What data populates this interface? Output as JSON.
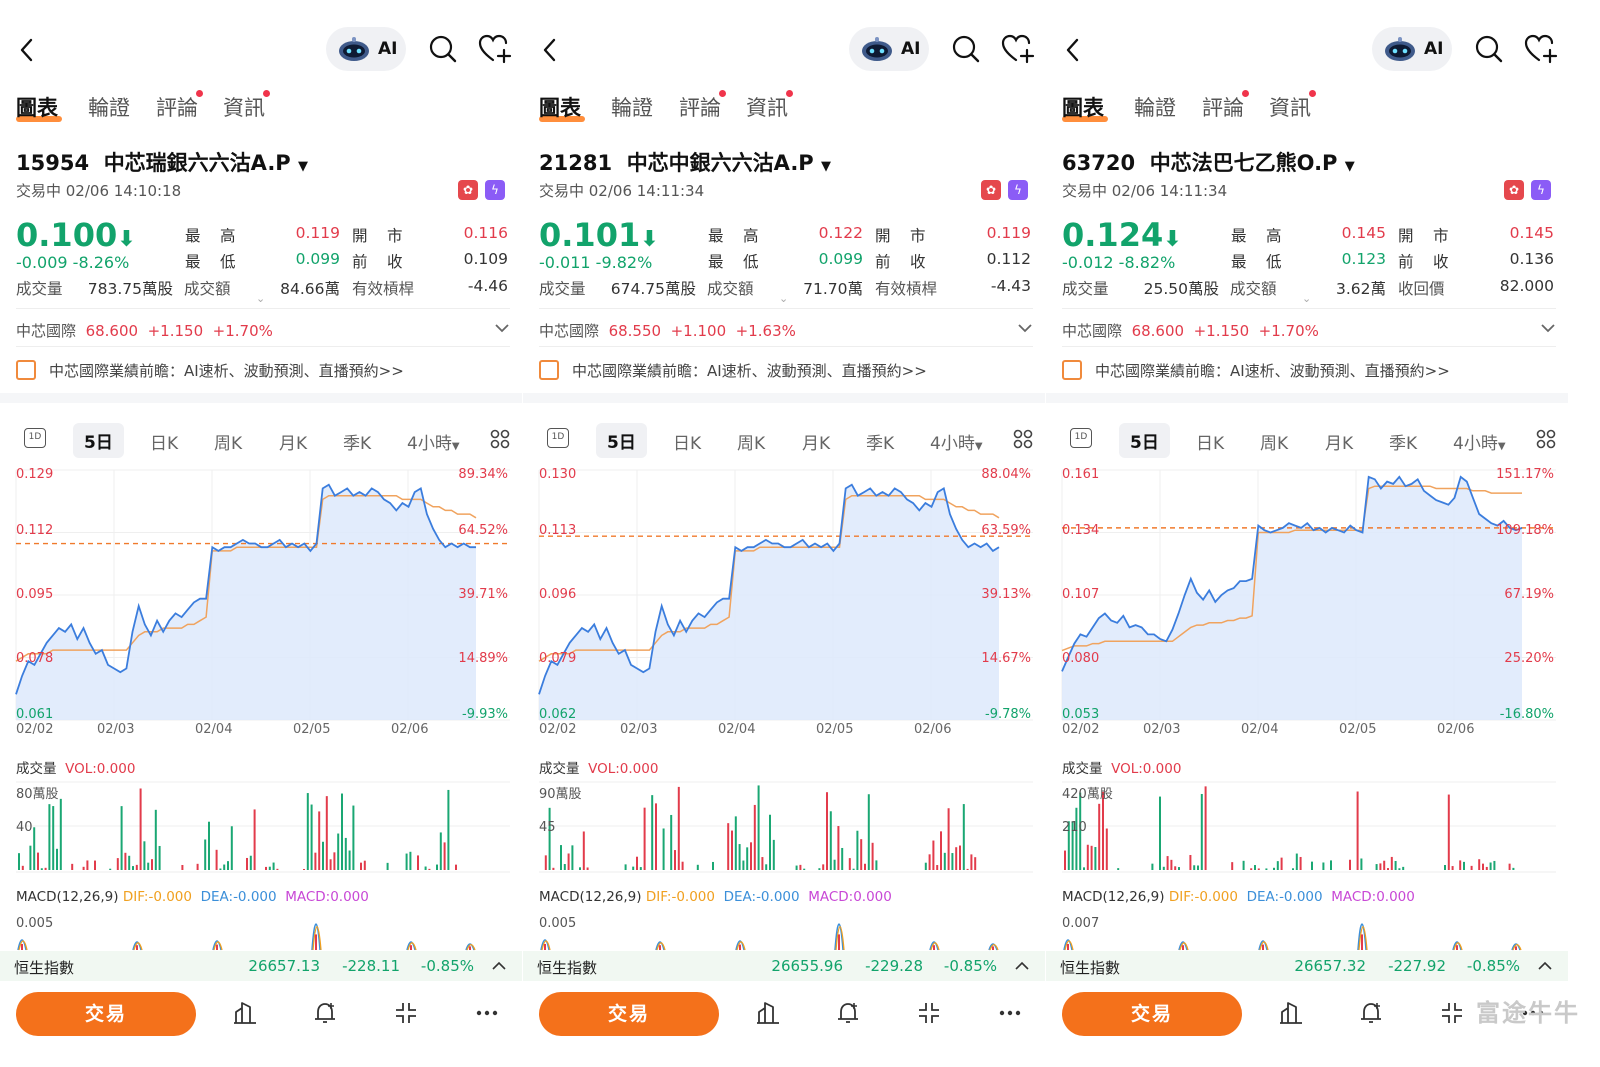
{
  "common": {
    "ai_label": "AI",
    "tabs": [
      "圖表",
      "輪證",
      "評論",
      "資訊"
    ],
    "q_high": "最　高",
    "q_low": "最　低",
    "q_open": "開　市",
    "q_prev": "前　收",
    "q_vol": "成交量",
    "q_turnover": "成交額",
    "underlying_name": "中芯國際",
    "news_text": "中芯國際業績前瞻：AI速析、波動預測、直播預約>>",
    "period_tabs": [
      "5日",
      "日K",
      "周K",
      "月K",
      "季K",
      "4小時"
    ],
    "period_1d": "1D",
    "x_dates": [
      "02/02",
      "02/03",
      "02/04",
      "02/05",
      "02/06"
    ],
    "vol_title": "成交量",
    "vol_value": "VOL:0.000",
    "macd_title": "MACD(12,26,9)",
    "macd_dif": "DIF:-0.000",
    "macd_dea": "DEA:-0.000",
    "macd_val": "MACD:0.000",
    "hsi_name": "恒生指數",
    "trade_label": "交易",
    "watermark": "富途牛牛",
    "colors": {
      "up": "#e23b4b",
      "down": "#12a36b",
      "accent": "#f4711b",
      "line": "#3b7ddd",
      "avg": "#f0a35e"
    }
  },
  "panels": [
    {
      "code": "15954",
      "name": "中芯瑞銀六六沽A.P",
      "status": "交易中 02/06 14:10:18",
      "price": "0.100",
      "change": "-0.009  -8.26%",
      "high": "0.119",
      "low": "0.099",
      "open": "0.116",
      "prev": "0.109",
      "volume": "783.75萬股",
      "turnover": "84.66萬",
      "extra_label": "有效槓桿",
      "extra_value": "-4.46",
      "u_price": "68.600",
      "u_chg": "+1.150",
      "u_pct": "+1.70%",
      "y_left": [
        "0.129",
        "0.112",
        "0.095",
        "0.078",
        "0.061"
      ],
      "y_right": [
        "89.34%",
        "64.52%",
        "39.71%",
        "14.89%",
        "-9.93%"
      ],
      "vol_top": "80萬股",
      "vol_mid": "40",
      "macd_top": "0.005",
      "hsi_value": "26657.13",
      "hsi_chg": "-228.11",
      "hsi_pct": "-0.85%",
      "chart_data": {
        "type": "line",
        "x_range": [
          "02/02",
          "02/06"
        ],
        "ylim": [
          0.061,
          0.129
        ],
        "prev_close": 0.109,
        "price": [
          0.068,
          0.073,
          0.077,
          0.076,
          0.079,
          0.082,
          0.084,
          0.086,
          0.085,
          0.087,
          0.083,
          0.086,
          0.082,
          0.079,
          0.08,
          0.076,
          0.075,
          0.074,
          0.075,
          0.085,
          0.092,
          0.087,
          0.084,
          0.088,
          0.085,
          0.088,
          0.09,
          0.089,
          0.091,
          0.093,
          0.094,
          0.094,
          0.108,
          0.107,
          0.108,
          0.108,
          0.109,
          0.11,
          0.109,
          0.109,
          0.108,
          0.108,
          0.109,
          0.11,
          0.108,
          0.109,
          0.108,
          0.109,
          0.107,
          0.109,
          0.124,
          0.125,
          0.122,
          0.123,
          0.124,
          0.122,
          0.123,
          0.122,
          0.124,
          0.123,
          0.121,
          0.12,
          0.118,
          0.12,
          0.119,
          0.123,
          0.124,
          0.117,
          0.113,
          0.11,
          0.108,
          0.109,
          0.108,
          0.109,
          0.108,
          0.108
        ],
        "avg": [
          0.077,
          0.078,
          0.079,
          0.079,
          0.079,
          0.079,
          0.08,
          0.08,
          0.08,
          0.08,
          0.08,
          0.08,
          0.08,
          0.08,
          0.08,
          0.08,
          0.08,
          0.08,
          0.08,
          0.082,
          0.084,
          0.085,
          0.085,
          0.085,
          0.086,
          0.086,
          0.086,
          0.086,
          0.087,
          0.087,
          0.088,
          0.089,
          0.107,
          0.107,
          0.107,
          0.107,
          0.108,
          0.108,
          0.108,
          0.108,
          0.108,
          0.108,
          0.108,
          0.108,
          0.108,
          0.108,
          0.108,
          0.108,
          0.108,
          0.108,
          0.121,
          0.122,
          0.122,
          0.122,
          0.122,
          0.122,
          0.122,
          0.122,
          0.122,
          0.122,
          0.122,
          0.122,
          0.122,
          0.121,
          0.121,
          0.121,
          0.121,
          0.12,
          0.119,
          0.119,
          0.118,
          0.118,
          0.117,
          0.117,
          0.117,
          0.116
        ]
      }
    },
    {
      "code": "21281",
      "name": "中芯中銀六六沽A.P",
      "status": "交易中 02/06 14:11:34",
      "price": "0.101",
      "change": "-0.011  -9.82%",
      "high": "0.122",
      "low": "0.099",
      "open": "0.119",
      "prev": "0.112",
      "volume": "674.75萬股",
      "turnover": "71.70萬",
      "extra_label": "有效槓桿",
      "extra_value": "-4.43",
      "u_price": "68.550",
      "u_chg": "+1.100",
      "u_pct": "+1.63%",
      "y_left": [
        "0.130",
        "0.113",
        "0.096",
        "0.079",
        "0.062"
      ],
      "y_right": [
        "88.04%",
        "63.59%",
        "39.13%",
        "14.67%",
        "-9.78%"
      ],
      "vol_top": "90萬股",
      "vol_mid": "45",
      "macd_top": "0.005",
      "hsi_value": "26655.96",
      "hsi_chg": "-229.28",
      "hsi_pct": "-0.85%",
      "chart_data": {
        "type": "line",
        "x_range": [
          "02/02",
          "02/06"
        ],
        "ylim": [
          0.062,
          0.13
        ],
        "prev_close": 0.112,
        "price": [
          0.069,
          0.074,
          0.078,
          0.077,
          0.08,
          0.083,
          0.085,
          0.087,
          0.086,
          0.088,
          0.084,
          0.087,
          0.083,
          0.08,
          0.081,
          0.077,
          0.076,
          0.075,
          0.076,
          0.086,
          0.093,
          0.088,
          0.085,
          0.089,
          0.086,
          0.089,
          0.091,
          0.09,
          0.092,
          0.094,
          0.095,
          0.095,
          0.109,
          0.108,
          0.109,
          0.109,
          0.11,
          0.111,
          0.11,
          0.11,
          0.109,
          0.109,
          0.11,
          0.111,
          0.109,
          0.11,
          0.109,
          0.11,
          0.108,
          0.11,
          0.125,
          0.126,
          0.123,
          0.124,
          0.125,
          0.123,
          0.124,
          0.123,
          0.125,
          0.124,
          0.122,
          0.121,
          0.119,
          0.121,
          0.12,
          0.124,
          0.125,
          0.118,
          0.114,
          0.111,
          0.109,
          0.11,
          0.109,
          0.11,
          0.108,
          0.109
        ],
        "avg": [
          0.078,
          0.079,
          0.08,
          0.08,
          0.08,
          0.08,
          0.081,
          0.081,
          0.081,
          0.081,
          0.081,
          0.081,
          0.081,
          0.081,
          0.081,
          0.081,
          0.081,
          0.081,
          0.081,
          0.083,
          0.085,
          0.086,
          0.086,
          0.086,
          0.087,
          0.087,
          0.087,
          0.087,
          0.088,
          0.088,
          0.089,
          0.09,
          0.108,
          0.108,
          0.108,
          0.108,
          0.109,
          0.109,
          0.109,
          0.109,
          0.109,
          0.109,
          0.109,
          0.109,
          0.109,
          0.109,
          0.109,
          0.109,
          0.109,
          0.109,
          0.122,
          0.123,
          0.123,
          0.123,
          0.123,
          0.123,
          0.123,
          0.123,
          0.123,
          0.123,
          0.123,
          0.123,
          0.123,
          0.122,
          0.122,
          0.122,
          0.122,
          0.121,
          0.12,
          0.12,
          0.119,
          0.119,
          0.118,
          0.118,
          0.118,
          0.117
        ]
      }
    },
    {
      "code": "63720",
      "name": "中芯法巴七乙熊O.P",
      "status": "交易中 02/06 14:11:34",
      "price": "0.124",
      "change": "-0.012  -8.82%",
      "high": "0.145",
      "low": "0.123",
      "open": "0.145",
      "prev": "0.136",
      "volume": "25.50萬股",
      "turnover": "3.62萬",
      "extra_label": "收回價",
      "extra_value": "82.000",
      "u_price": "68.600",
      "u_chg": "+1.150",
      "u_pct": "+1.70%",
      "y_left": [
        "0.161",
        "0.134",
        "0.107",
        "0.080",
        "0.053"
      ],
      "y_right": [
        "151.17%",
        "109.18%",
        "67.19%",
        "25.20%",
        "-16.80%"
      ],
      "vol_top": "420萬股",
      "vol_mid": "210",
      "macd_top": "0.007",
      "hsi_value": "26657.32",
      "hsi_chg": "-227.92",
      "hsi_pct": "-0.85%",
      "chart_data": {
        "type": "line",
        "x_range": [
          "02/02",
          "02/06"
        ],
        "ylim": [
          0.053,
          0.161
        ],
        "prev_close": 0.136,
        "price": [
          0.074,
          0.08,
          0.086,
          0.09,
          0.089,
          0.093,
          0.097,
          0.099,
          0.096,
          0.095,
          0.098,
          0.093,
          0.094,
          0.093,
          0.09,
          0.09,
          0.088,
          0.087,
          0.092,
          0.099,
          0.107,
          0.114,
          0.108,
          0.105,
          0.109,
          0.104,
          0.107,
          0.109,
          0.11,
          0.113,
          0.113,
          0.114,
          0.137,
          0.135,
          0.134,
          0.135,
          0.136,
          0.138,
          0.137,
          0.136,
          0.138,
          0.135,
          0.136,
          0.134,
          0.136,
          0.135,
          0.134,
          0.137,
          0.135,
          0.134,
          0.158,
          0.157,
          0.153,
          0.156,
          0.155,
          0.158,
          0.154,
          0.155,
          0.157,
          0.152,
          0.15,
          0.148,
          0.147,
          0.146,
          0.149,
          0.158,
          0.156,
          0.149,
          0.142,
          0.14,
          0.138,
          0.137,
          0.139,
          0.136,
          0.135,
          0.136
        ],
        "avg": [
          0.083,
          0.084,
          0.085,
          0.085,
          0.085,
          0.086,
          0.086,
          0.087,
          0.087,
          0.087,
          0.087,
          0.087,
          0.087,
          0.087,
          0.087,
          0.087,
          0.087,
          0.087,
          0.087,
          0.089,
          0.091,
          0.093,
          0.094,
          0.094,
          0.095,
          0.095,
          0.095,
          0.096,
          0.096,
          0.097,
          0.097,
          0.098,
          0.134,
          0.134,
          0.134,
          0.134,
          0.134,
          0.134,
          0.135,
          0.135,
          0.135,
          0.135,
          0.135,
          0.135,
          0.135,
          0.135,
          0.135,
          0.135,
          0.135,
          0.135,
          0.153,
          0.154,
          0.154,
          0.154,
          0.154,
          0.154,
          0.154,
          0.154,
          0.154,
          0.154,
          0.154,
          0.153,
          0.153,
          0.153,
          0.153,
          0.153,
          0.153,
          0.152,
          0.152,
          0.152,
          0.151,
          0.151,
          0.151,
          0.151,
          0.151,
          0.151
        ]
      }
    }
  ]
}
